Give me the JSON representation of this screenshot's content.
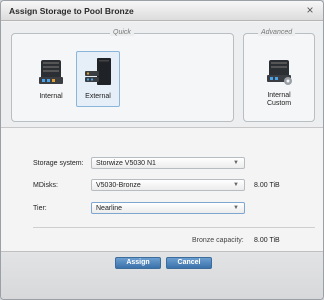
{
  "dialog": {
    "title": "Assign Storage to Pool Bronze",
    "close_glyph": "×"
  },
  "quick": {
    "label": "Quick",
    "options": [
      {
        "label": "Internal",
        "icon": "internal-storage-icon",
        "selected": false
      },
      {
        "label": "External",
        "icon": "external-storage-icon",
        "selected": true
      }
    ]
  },
  "advanced": {
    "label": "Advanced",
    "options": [
      {
        "label_line1": "Internal",
        "label_line2": "Custom",
        "icon": "internal-custom-storage-icon"
      }
    ]
  },
  "form": {
    "storage_system": {
      "label": "Storage system:",
      "value": "Storwize V5030 N1"
    },
    "mdisks": {
      "label": "MDisks:",
      "value": "V5030-Bronze",
      "size": "8.00 TiB"
    },
    "tier": {
      "label": "Tier:",
      "value": "Nearline"
    },
    "capacity": {
      "label": "Bronze capacity:",
      "value": "8.00 TiB"
    }
  },
  "footer": {
    "assign_label": "Assign",
    "cancel_label": "Cancel"
  },
  "colors": {
    "accent": "#3b72aa",
    "selected_bg": "#e6eff8",
    "selected_border": "#8ab6dc"
  }
}
